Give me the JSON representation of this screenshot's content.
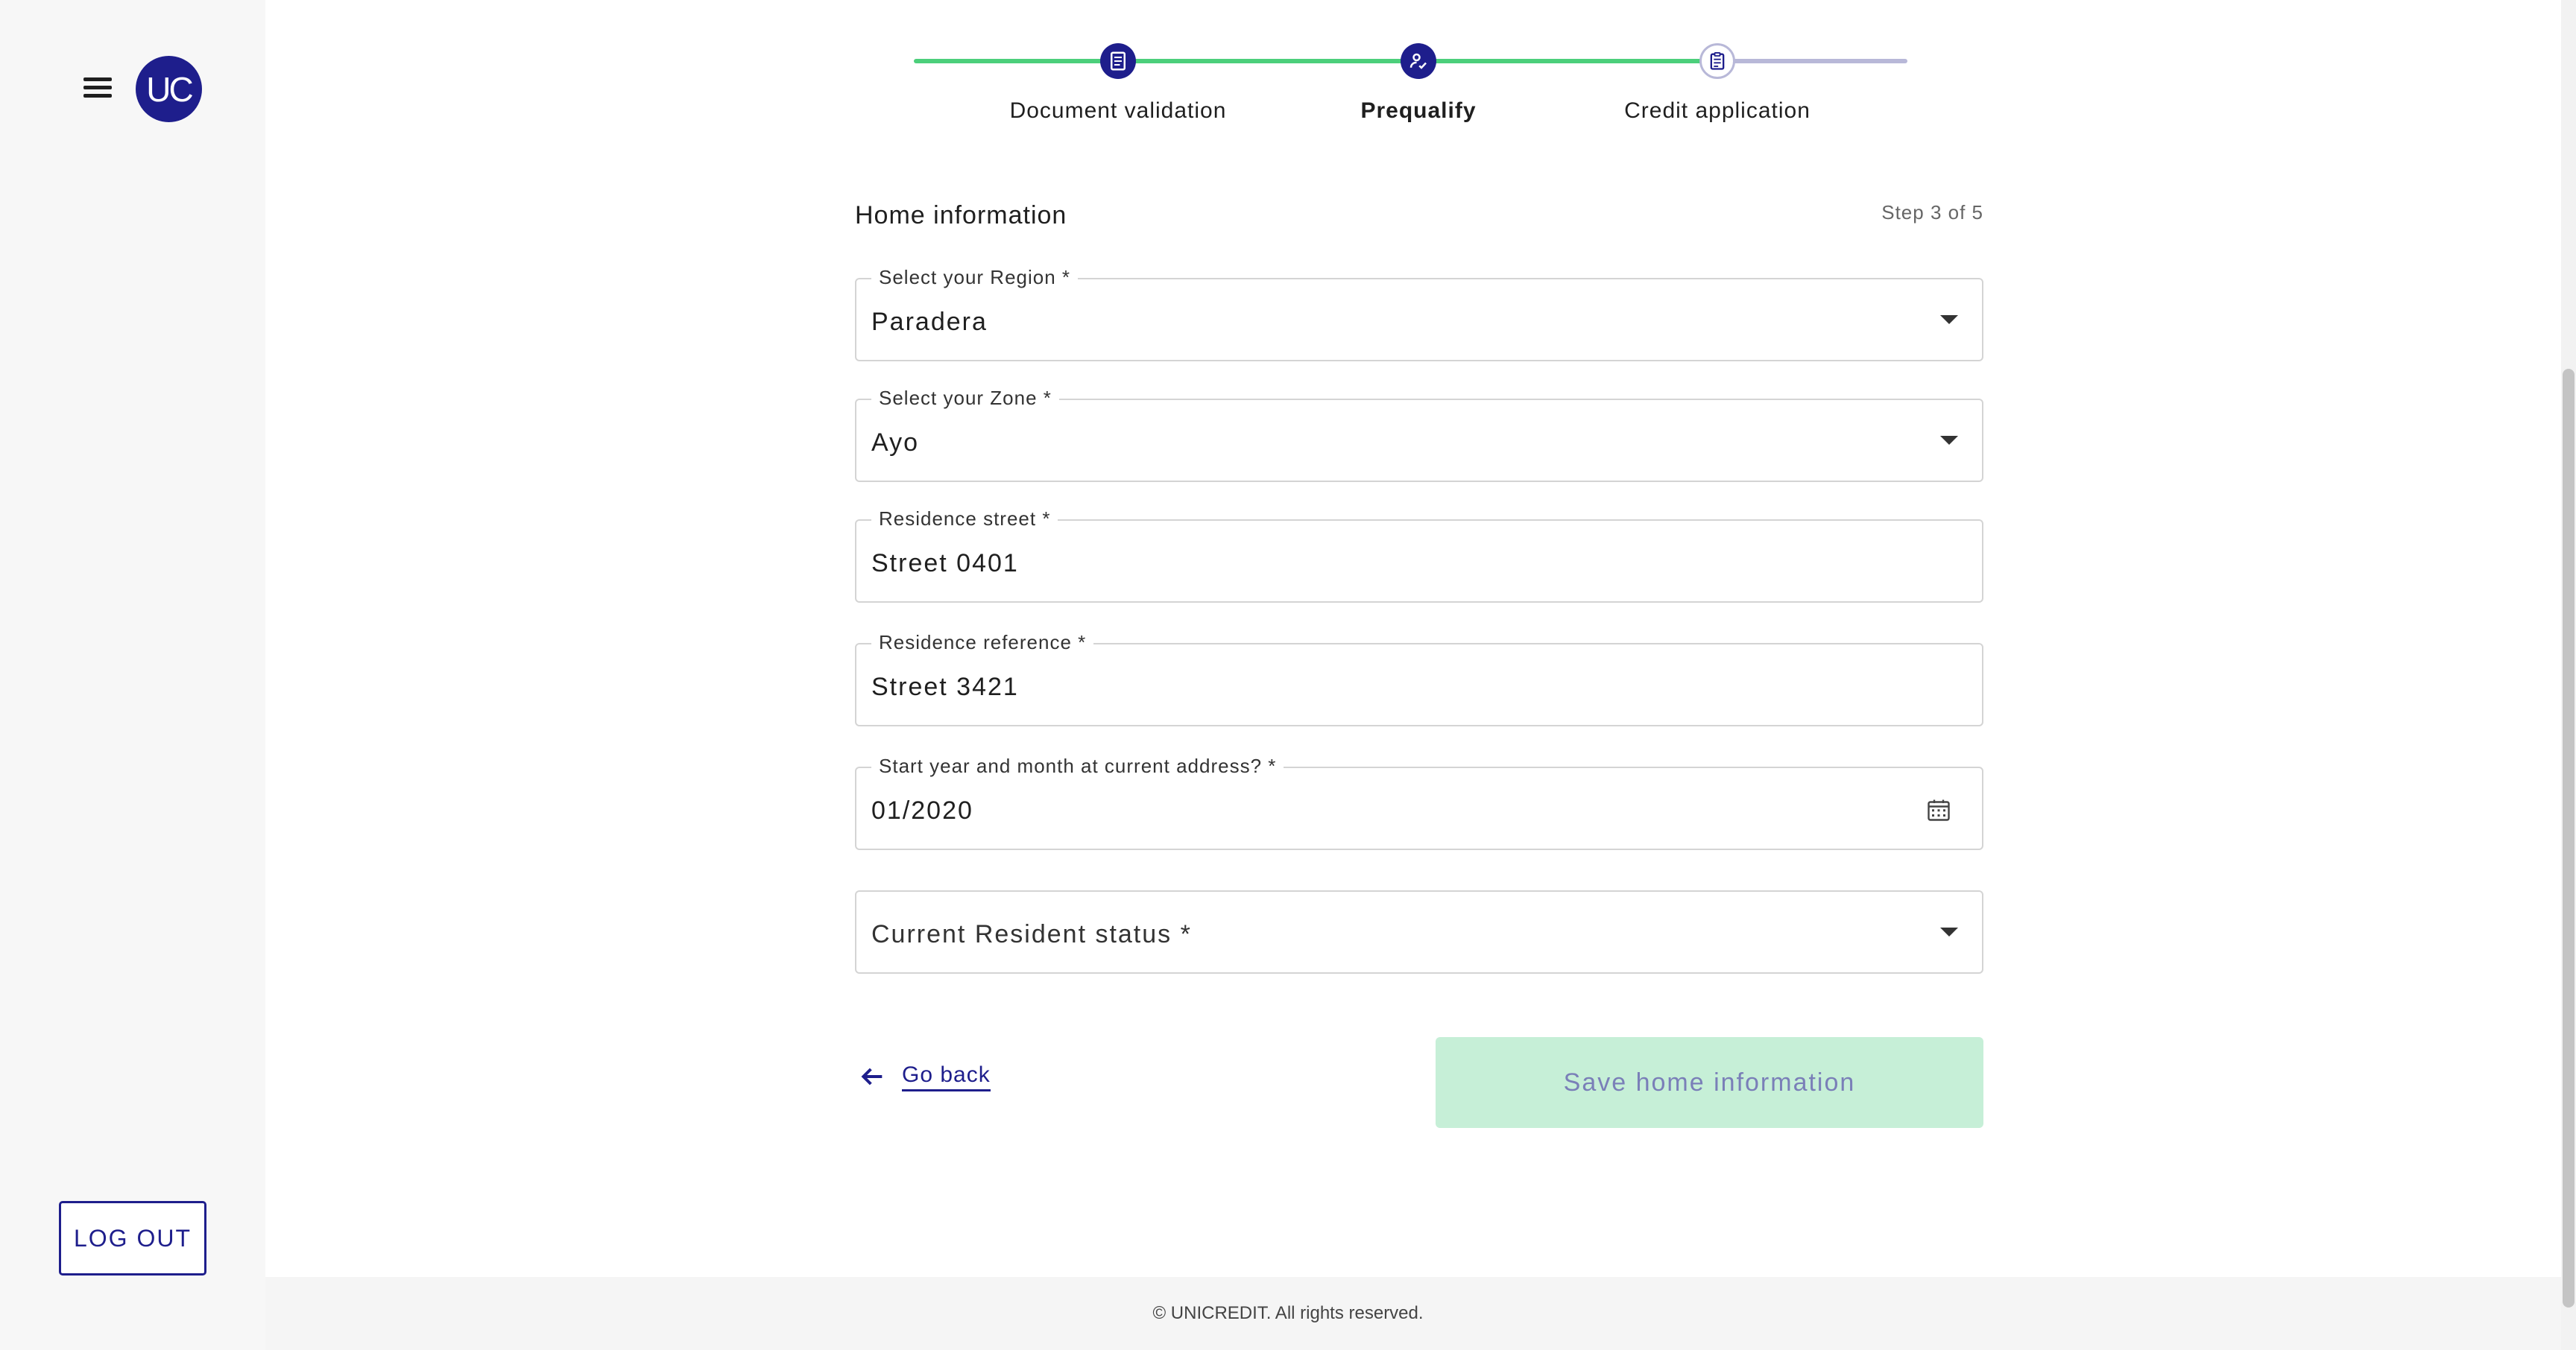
{
  "sidebar": {
    "menu_icon": "hamburger-menu-icon",
    "avatar_initials": "UC",
    "logout_label": "LOG OUT"
  },
  "stepper": {
    "steps": [
      {
        "label": "Document validation",
        "icon": "document-icon",
        "state": "completed"
      },
      {
        "label": "Prequalify",
        "icon": "signature-icon",
        "state": "active"
      },
      {
        "label": "Credit application",
        "icon": "clipboard-icon",
        "state": "pending"
      }
    ]
  },
  "form": {
    "title": "Home information",
    "step_counter": "Step 3 of 5",
    "fields": [
      {
        "label": "Select your Region *",
        "value": "Paradera",
        "type": "select"
      },
      {
        "label": "Select your Zone *",
        "value": "Ayo",
        "type": "select"
      },
      {
        "label": "Residence street *",
        "value": "Street 0401",
        "type": "text"
      },
      {
        "label": "Residence reference *",
        "value": "Street 3421",
        "type": "text"
      },
      {
        "label": "Start year and month at current address? *",
        "value": "01/2020",
        "type": "date"
      },
      {
        "label": "Current Resident status *",
        "value": "",
        "type": "select"
      }
    ]
  },
  "actions": {
    "go_back_label": "Go back",
    "save_label": "Save home information"
  },
  "footer": {
    "copyright": "© UNICREDIT. All rights reserved."
  },
  "colors": {
    "brand": "#1e1e8c",
    "progress": "#4ccf7b",
    "save_button_disabled": "#c6efd7"
  }
}
